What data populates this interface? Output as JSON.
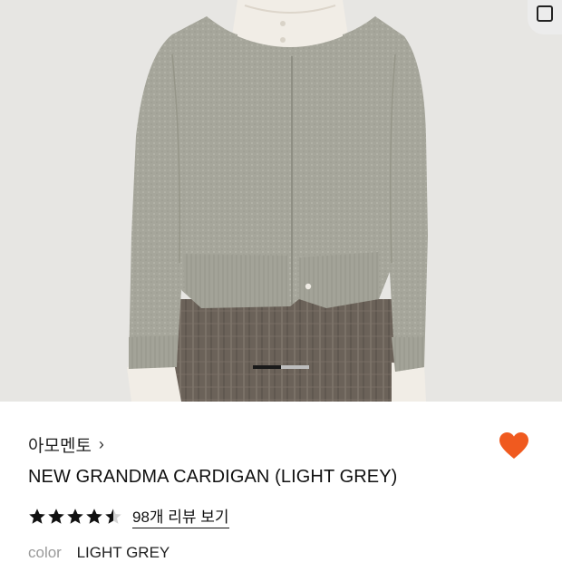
{
  "product": {
    "brand": "아모멘토",
    "brand_chevron": "›",
    "title": "NEW GRANDMA CARDIGAN (LIGHT GREY)",
    "rating": 4.5,
    "review_link": "98개 리뷰 보기",
    "color_label": "color",
    "color_value": "LIGHT GREY"
  },
  "gallery": {
    "image_subject": "model wearing grey knit cardigan over ruffled white blouse and plaid pleated skirt",
    "current_page": 1,
    "page_count": 2
  },
  "icons": {
    "wishlist": "heart-icon",
    "wishlist_color": "#f05a1f",
    "cart": "cart-icon",
    "brand_arrow": "chevron-right-icon"
  },
  "colors": {
    "cardigan": "#a6a69b",
    "background": "#e7e6e3",
    "skirt": "#6b6259",
    "blouse": "#f1ede6"
  }
}
